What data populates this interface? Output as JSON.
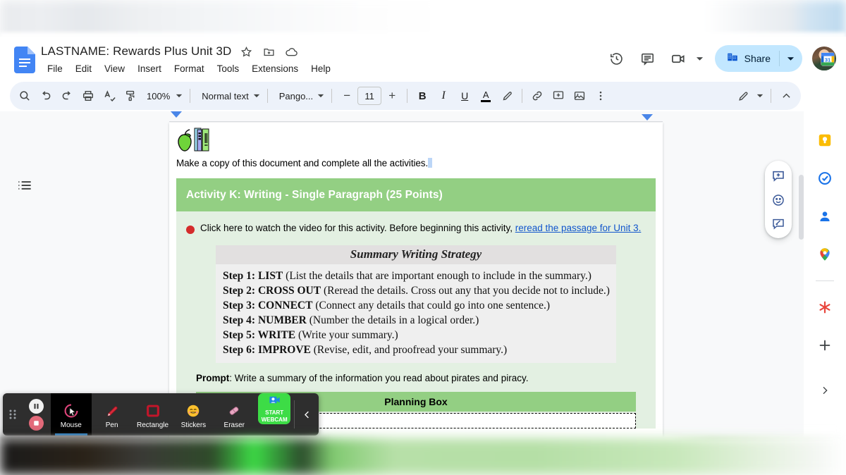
{
  "app": {
    "doc_title": "LASTNAME: Rewards Plus Unit 3D",
    "logo_name": "google-docs-logo",
    "title_icons": [
      "star-icon",
      "move-to-folder-icon",
      "cloud-saved-icon"
    ],
    "menus": [
      "File",
      "Edit",
      "View",
      "Insert",
      "Format",
      "Tools",
      "Extensions",
      "Help"
    ],
    "header_right": {
      "history_icon": "version-history-icon",
      "comment_icon": "comment-history-icon",
      "meet_icon": "google-meet-icon",
      "meet_caret": "chevron-down-icon",
      "share_label": "Share",
      "share_icon": "share-building-icon",
      "share_caret": "chevron-down-icon",
      "avatar_name": "user-avatar"
    }
  },
  "toolbar": {
    "search_icon": "search-icon",
    "undo_icon": "undo-icon",
    "redo_icon": "redo-icon",
    "print_icon": "print-icon",
    "spellcheck_icon": "spellcheck-icon",
    "paint_format_icon": "paint-format-icon",
    "zoom_value": "100%",
    "style_value": "Normal text",
    "font_value": "Pango...",
    "minus_label": "−",
    "font_size": "11",
    "plus_label": "+",
    "bold_label": "B",
    "italic_label": "I",
    "underline_label": "U",
    "text_color_label": "A",
    "highlight_icon": "highlight-pen-icon",
    "link_icon": "insert-link-icon",
    "comment_icon": "add-comment-icon",
    "image_icon": "insert-image-icon",
    "more_icon": "more-options-icon",
    "mode_icon": "editing-mode-pencil-icon",
    "mode_caret": "chevron-down-icon",
    "collapse_icon": "chevron-up-icon"
  },
  "editor": {
    "outline_icon": "document-outline-icon",
    "ruler": {
      "left_indent": "left-indent-marker",
      "right_indent": "right-indent-marker"
    },
    "page": {
      "header_image": "apple-and-books-clipart",
      "intro_text": "Make a copy of this document and complete all the activities.",
      "activity_banner": "Activity K: Writing - Single Paragraph (25 Points)",
      "video_bullet": "red-dot-bullet",
      "video_text": "Click here to watch the video for this activity. Before beginning this activity, ",
      "video_link": "reread the passage for Unit 3.",
      "strategy_title": "Summary Writing Strategy",
      "strategy_steps": [
        {
          "label": "Step 1: LIST",
          "desc": " (List the details that are important enough to include in the summary.)"
        },
        {
          "label": "Step 2: CROSS OUT",
          "desc": " (Reread the details. Cross out any that you decide not to include.)"
        },
        {
          "label": "Step 3: CONNECT",
          "desc": " (Connect any details that could go into one sentence.)"
        },
        {
          "label": "Step 4: NUMBER",
          "desc": " (Number the details in a logical order.)"
        },
        {
          "label": "Step 5: WRITE",
          "desc": " (Write your summary.)"
        },
        {
          "label": "Step 6: IMPROVE",
          "desc": " (Revise, edit, and proofread your summary.)"
        }
      ],
      "prompt_label": "Prompt",
      "prompt_text": ": Write a summary of the information you read about pirates and piracy.",
      "planning_banner": "Planning Box",
      "planning_input_value": ""
    },
    "colors": {
      "banner_green": "#93cf83",
      "body_green": "#e3f0e2",
      "link_blue": "#1155cc",
      "bullet_red": "#d42b2b"
    }
  },
  "right_rail": {
    "calendar_icon": "google-calendar-icon",
    "calendar_badge": "31",
    "items": [
      {
        "name": "google-keep-icon"
      },
      {
        "name": "google-tasks-icon"
      },
      {
        "name": "google-contacts-icon"
      },
      {
        "name": "google-maps-icon"
      },
      {
        "name": "add-on-asterisk-icon"
      },
      {
        "name": "get-add-ons-plus-icon"
      }
    ],
    "expand_icon": "chevron-right-icon",
    "comment_cluster": [
      "add-comment-icon",
      "add-emoji-reaction-icon",
      "suggest-edit-icon"
    ],
    "scrollbar": "vertical-scrollbar"
  },
  "annotation_toolbar": {
    "grip_icon": "drag-handle-icon",
    "pause_icon": "pause-recording-icon",
    "stop_icon": "stop-recording-icon",
    "tools": [
      {
        "label": "Mouse",
        "icon": "mouse-cursor-icon",
        "active": true
      },
      {
        "label": "Pen",
        "icon": "pen-icon",
        "active": false
      },
      {
        "label": "Rectangle",
        "icon": "rectangle-icon",
        "active": false
      },
      {
        "label": "Stickers",
        "icon": "sticker-smiley-icon",
        "active": false
      },
      {
        "label": "Eraser",
        "icon": "eraser-icon",
        "active": false
      }
    ],
    "webcam_line1": "START",
    "webcam_line2": "WEBCAM",
    "webcam_icon": "webcam-icon",
    "collapse_icon": "chevron-left-icon"
  }
}
